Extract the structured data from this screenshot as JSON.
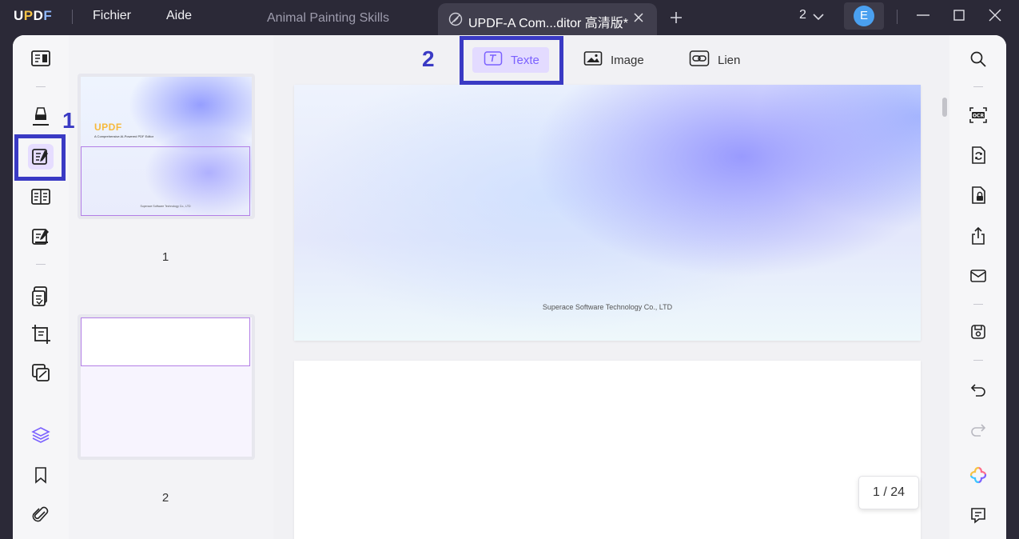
{
  "app": {
    "logo": {
      "u": "U",
      "p": "P",
      "d": "D",
      "f": "F"
    },
    "menu": [
      "Fichier",
      "Aide"
    ]
  },
  "tabs": {
    "inactive": "Animal Painting Skills",
    "active": "UPDF-A Com...ditor 高清版*"
  },
  "window": {
    "count": "2",
    "avatar_initial": "E"
  },
  "toolbar": {
    "text_label": "Texte",
    "image_label": "Image",
    "link_label": "Lien"
  },
  "thumbnails": [
    {
      "number": "1",
      "logo": "UPDF",
      "subtitle": "A Comprehensive AI-Powered PDF Editor",
      "footer": "Superace Software Technology Co., LTD"
    },
    {
      "number": "2"
    }
  ],
  "document": {
    "page1_footer": "Superace Software Technology Co., LTD",
    "page_indicator": "1 / 24"
  },
  "annotations": [
    "1",
    "2"
  ],
  "colors": {
    "accent": "#7b61ff",
    "highlight": "#3a3ac4",
    "titlebar": "#2b2937"
  },
  "icons": {
    "left_rail": [
      "reader-icon",
      "comment-marker-icon",
      "edit-pdf-icon",
      "organize-pages-icon",
      "fill-sign-icon",
      "convert-icon",
      "crop-icon",
      "compare-icon",
      "layers-icon",
      "bookmark-icon",
      "attachment-icon"
    ],
    "right_rail": [
      "search-icon",
      "ocr-icon",
      "convert-pdf-icon",
      "protect-icon",
      "share-icon",
      "email-icon",
      "save-icon",
      "undo-icon",
      "redo-icon",
      "ai-assistant-icon",
      "comments-list-icon"
    ]
  }
}
